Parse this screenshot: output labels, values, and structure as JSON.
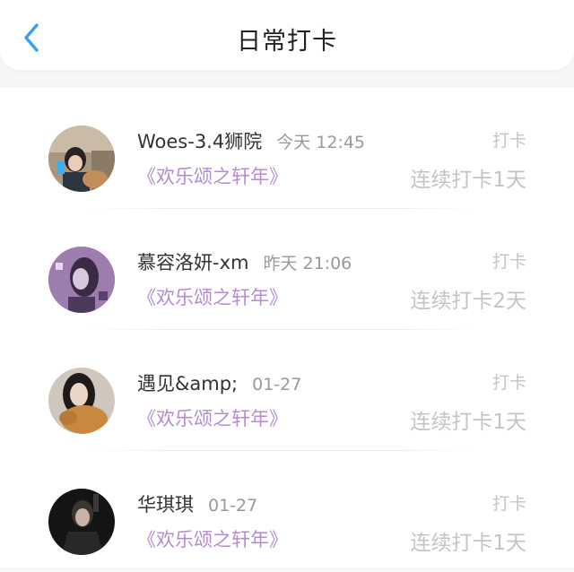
{
  "header": {
    "title": "日常打卡",
    "back_icon": "chevron-left-icon",
    "accent": "#3a9ff0"
  },
  "items": [
    {
      "name": "Woes-3.4狮院",
      "time": "今天 12:45",
      "book": "《欢乐颂之轩年》",
      "label": "打卡",
      "streak": "连续打卡1天"
    },
    {
      "name": "慕容洛妍-xm",
      "time": "昨天 21:06",
      "book": "《欢乐颂之轩年》",
      "label": "打卡",
      "streak": "连续打卡2天"
    },
    {
      "name": "遇见&amp;",
      "time": "01-27",
      "book": "《欢乐颂之轩年》",
      "label": "打卡",
      "streak": "连续打卡1天"
    },
    {
      "name": "华琪琪",
      "time": "01-27",
      "book": "《欢乐颂之轩年》",
      "label": "打卡",
      "streak": "连续打卡1天"
    }
  ],
  "colors": {
    "book_link": "#b58ad6",
    "muted": "#c4c4c4"
  }
}
